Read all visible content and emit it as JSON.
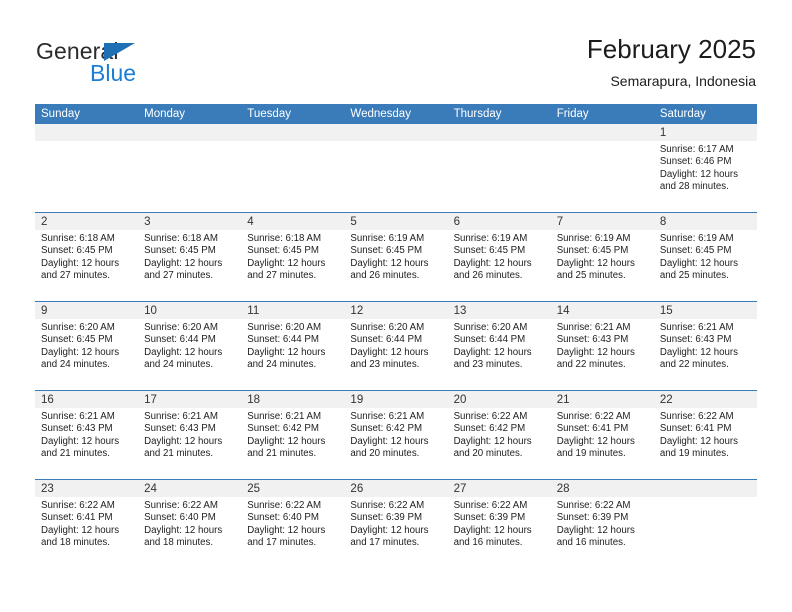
{
  "brand": {
    "word_one": "General",
    "word_two": "Blue",
    "triangle_color": "#1f6fb5",
    "blue_color": "#1a7fd4"
  },
  "header": {
    "title": "February 2025",
    "subtitle": "Semarapura, Indonesia"
  },
  "theme": {
    "header_blue": "#3a7cba",
    "daynum_band": "#f1f1f1",
    "text": "#1e1e1e"
  },
  "weekdays": [
    "Sunday",
    "Monday",
    "Tuesday",
    "Wednesday",
    "Thursday",
    "Friday",
    "Saturday"
  ],
  "weeks": [
    [
      {
        "day": "",
        "sunrise": "",
        "sunset": "",
        "daylight_line1": "",
        "daylight_line2": ""
      },
      {
        "day": "",
        "sunrise": "",
        "sunset": "",
        "daylight_line1": "",
        "daylight_line2": ""
      },
      {
        "day": "",
        "sunrise": "",
        "sunset": "",
        "daylight_line1": "",
        "daylight_line2": ""
      },
      {
        "day": "",
        "sunrise": "",
        "sunset": "",
        "daylight_line1": "",
        "daylight_line2": ""
      },
      {
        "day": "",
        "sunrise": "",
        "sunset": "",
        "daylight_line1": "",
        "daylight_line2": ""
      },
      {
        "day": "",
        "sunrise": "",
        "sunset": "",
        "daylight_line1": "",
        "daylight_line2": ""
      },
      {
        "day": "1",
        "sunrise": "Sunrise: 6:17 AM",
        "sunset": "Sunset: 6:46 PM",
        "daylight_line1": "Daylight: 12 hours",
        "daylight_line2": "and 28 minutes."
      }
    ],
    [
      {
        "day": "2",
        "sunrise": "Sunrise: 6:18 AM",
        "sunset": "Sunset: 6:45 PM",
        "daylight_line1": "Daylight: 12 hours",
        "daylight_line2": "and 27 minutes."
      },
      {
        "day": "3",
        "sunrise": "Sunrise: 6:18 AM",
        "sunset": "Sunset: 6:45 PM",
        "daylight_line1": "Daylight: 12 hours",
        "daylight_line2": "and 27 minutes."
      },
      {
        "day": "4",
        "sunrise": "Sunrise: 6:18 AM",
        "sunset": "Sunset: 6:45 PM",
        "daylight_line1": "Daylight: 12 hours",
        "daylight_line2": "and 27 minutes."
      },
      {
        "day": "5",
        "sunrise": "Sunrise: 6:19 AM",
        "sunset": "Sunset: 6:45 PM",
        "daylight_line1": "Daylight: 12 hours",
        "daylight_line2": "and 26 minutes."
      },
      {
        "day": "6",
        "sunrise": "Sunrise: 6:19 AM",
        "sunset": "Sunset: 6:45 PM",
        "daylight_line1": "Daylight: 12 hours",
        "daylight_line2": "and 26 minutes."
      },
      {
        "day": "7",
        "sunrise": "Sunrise: 6:19 AM",
        "sunset": "Sunset: 6:45 PM",
        "daylight_line1": "Daylight: 12 hours",
        "daylight_line2": "and 25 minutes."
      },
      {
        "day": "8",
        "sunrise": "Sunrise: 6:19 AM",
        "sunset": "Sunset: 6:45 PM",
        "daylight_line1": "Daylight: 12 hours",
        "daylight_line2": "and 25 minutes."
      }
    ],
    [
      {
        "day": "9",
        "sunrise": "Sunrise: 6:20 AM",
        "sunset": "Sunset: 6:45 PM",
        "daylight_line1": "Daylight: 12 hours",
        "daylight_line2": "and 24 minutes."
      },
      {
        "day": "10",
        "sunrise": "Sunrise: 6:20 AM",
        "sunset": "Sunset: 6:44 PM",
        "daylight_line1": "Daylight: 12 hours",
        "daylight_line2": "and 24 minutes."
      },
      {
        "day": "11",
        "sunrise": "Sunrise: 6:20 AM",
        "sunset": "Sunset: 6:44 PM",
        "daylight_line1": "Daylight: 12 hours",
        "daylight_line2": "and 24 minutes."
      },
      {
        "day": "12",
        "sunrise": "Sunrise: 6:20 AM",
        "sunset": "Sunset: 6:44 PM",
        "daylight_line1": "Daylight: 12 hours",
        "daylight_line2": "and 23 minutes."
      },
      {
        "day": "13",
        "sunrise": "Sunrise: 6:20 AM",
        "sunset": "Sunset: 6:44 PM",
        "daylight_line1": "Daylight: 12 hours",
        "daylight_line2": "and 23 minutes."
      },
      {
        "day": "14",
        "sunrise": "Sunrise: 6:21 AM",
        "sunset": "Sunset: 6:43 PM",
        "daylight_line1": "Daylight: 12 hours",
        "daylight_line2": "and 22 minutes."
      },
      {
        "day": "15",
        "sunrise": "Sunrise: 6:21 AM",
        "sunset": "Sunset: 6:43 PM",
        "daylight_line1": "Daylight: 12 hours",
        "daylight_line2": "and 22 minutes."
      }
    ],
    [
      {
        "day": "16",
        "sunrise": "Sunrise: 6:21 AM",
        "sunset": "Sunset: 6:43 PM",
        "daylight_line1": "Daylight: 12 hours",
        "daylight_line2": "and 21 minutes."
      },
      {
        "day": "17",
        "sunrise": "Sunrise: 6:21 AM",
        "sunset": "Sunset: 6:43 PM",
        "daylight_line1": "Daylight: 12 hours",
        "daylight_line2": "and 21 minutes."
      },
      {
        "day": "18",
        "sunrise": "Sunrise: 6:21 AM",
        "sunset": "Sunset: 6:42 PM",
        "daylight_line1": "Daylight: 12 hours",
        "daylight_line2": "and 21 minutes."
      },
      {
        "day": "19",
        "sunrise": "Sunrise: 6:21 AM",
        "sunset": "Sunset: 6:42 PM",
        "daylight_line1": "Daylight: 12 hours",
        "daylight_line2": "and 20 minutes."
      },
      {
        "day": "20",
        "sunrise": "Sunrise: 6:22 AM",
        "sunset": "Sunset: 6:42 PM",
        "daylight_line1": "Daylight: 12 hours",
        "daylight_line2": "and 20 minutes."
      },
      {
        "day": "21",
        "sunrise": "Sunrise: 6:22 AM",
        "sunset": "Sunset: 6:41 PM",
        "daylight_line1": "Daylight: 12 hours",
        "daylight_line2": "and 19 minutes."
      },
      {
        "day": "22",
        "sunrise": "Sunrise: 6:22 AM",
        "sunset": "Sunset: 6:41 PM",
        "daylight_line1": "Daylight: 12 hours",
        "daylight_line2": "and 19 minutes."
      }
    ],
    [
      {
        "day": "23",
        "sunrise": "Sunrise: 6:22 AM",
        "sunset": "Sunset: 6:41 PM",
        "daylight_line1": "Daylight: 12 hours",
        "daylight_line2": "and 18 minutes."
      },
      {
        "day": "24",
        "sunrise": "Sunrise: 6:22 AM",
        "sunset": "Sunset: 6:40 PM",
        "daylight_line1": "Daylight: 12 hours",
        "daylight_line2": "and 18 minutes."
      },
      {
        "day": "25",
        "sunrise": "Sunrise: 6:22 AM",
        "sunset": "Sunset: 6:40 PM",
        "daylight_line1": "Daylight: 12 hours",
        "daylight_line2": "and 17 minutes."
      },
      {
        "day": "26",
        "sunrise": "Sunrise: 6:22 AM",
        "sunset": "Sunset: 6:39 PM",
        "daylight_line1": "Daylight: 12 hours",
        "daylight_line2": "and 17 minutes."
      },
      {
        "day": "27",
        "sunrise": "Sunrise: 6:22 AM",
        "sunset": "Sunset: 6:39 PM",
        "daylight_line1": "Daylight: 12 hours",
        "daylight_line2": "and 16 minutes."
      },
      {
        "day": "28",
        "sunrise": "Sunrise: 6:22 AM",
        "sunset": "Sunset: 6:39 PM",
        "daylight_line1": "Daylight: 12 hours",
        "daylight_line2": "and 16 minutes."
      },
      {
        "day": "",
        "sunrise": "",
        "sunset": "",
        "daylight_line1": "",
        "daylight_line2": ""
      }
    ]
  ]
}
